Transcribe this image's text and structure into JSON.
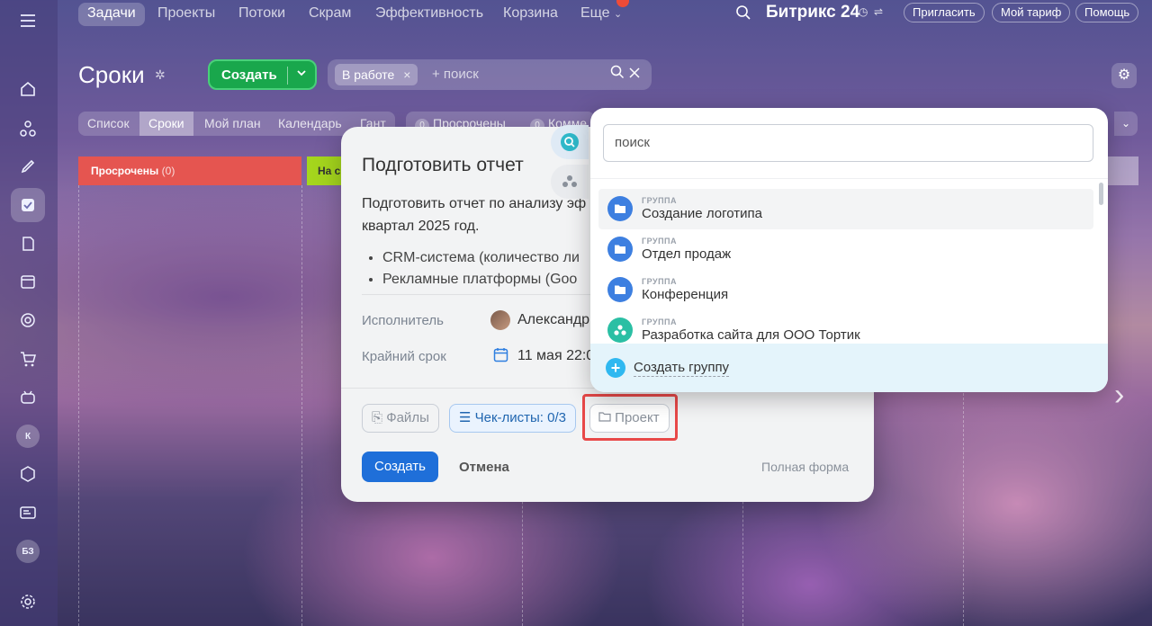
{
  "topnav": {
    "tabs": [
      "Задачи",
      "Проекты",
      "Потоки",
      "Скрам",
      "Эффективность",
      "Корзина",
      "Еще"
    ],
    "brand": "Битрикс 24",
    "invite": "Пригласить",
    "tariff": "Мой тариф",
    "help": "Помощь"
  },
  "sidebar": {
    "avatar_k": "К",
    "avatar_bz": "БЗ"
  },
  "header": {
    "title": "Сроки",
    "create_label": "Создать",
    "filter_chip": "В работе",
    "search_placeholder": "+ поиск"
  },
  "views": {
    "tabs": [
      "Список",
      "Сроки",
      "Мой план",
      "Календарь",
      "Гант"
    ],
    "counter_overdue": "Просрочены",
    "counter_comments": "Комме",
    "counter_value": "0"
  },
  "kanban": {
    "overdue_title": "Просрочены",
    "overdue_count": "(0)",
    "next_title": "На с"
  },
  "task_card": {
    "title": "Подготовить отчет",
    "description": "Подготовить отчет по анализу эф квартал 2025 год.",
    "bullets": [
      "CRM-система (количество ли",
      "Рекламные платформы (Goo"
    ],
    "assignee_label": "Исполнитель",
    "assignee_value": "Александр",
    "deadline_label": "Крайний срок",
    "deadline_value": "11 мая 22:0",
    "files_button": "Файлы",
    "checklists_button": "Чек-листы: 0/3",
    "project_button": "Проект",
    "create_button": "Создать",
    "cancel_button": "Отмена",
    "full_form_link": "Полная форма"
  },
  "dropdown": {
    "search_placeholder": "поиск",
    "items": [
      {
        "caption": "ГРУППА",
        "name": "Создание логотипа",
        "icon": "folder-icon"
      },
      {
        "caption": "ГРУППА",
        "name": "Отдел продаж",
        "icon": "folder-icon"
      },
      {
        "caption": "ГРУППА",
        "name": "Конференция",
        "icon": "folder-icon"
      },
      {
        "caption": "ГРУППА",
        "name": "Разработка сайта для ООО Тортик",
        "icon": "group-icon"
      }
    ],
    "create_group": "Создать группу"
  },
  "colors": {
    "create_green": "#19a74c",
    "overdue_red": "#e55550",
    "primary_blue": "#1f6fd9",
    "highlight_red": "#e84848",
    "folder_blue": "#3d7fe0",
    "group_teal": "#2bbfa4"
  }
}
